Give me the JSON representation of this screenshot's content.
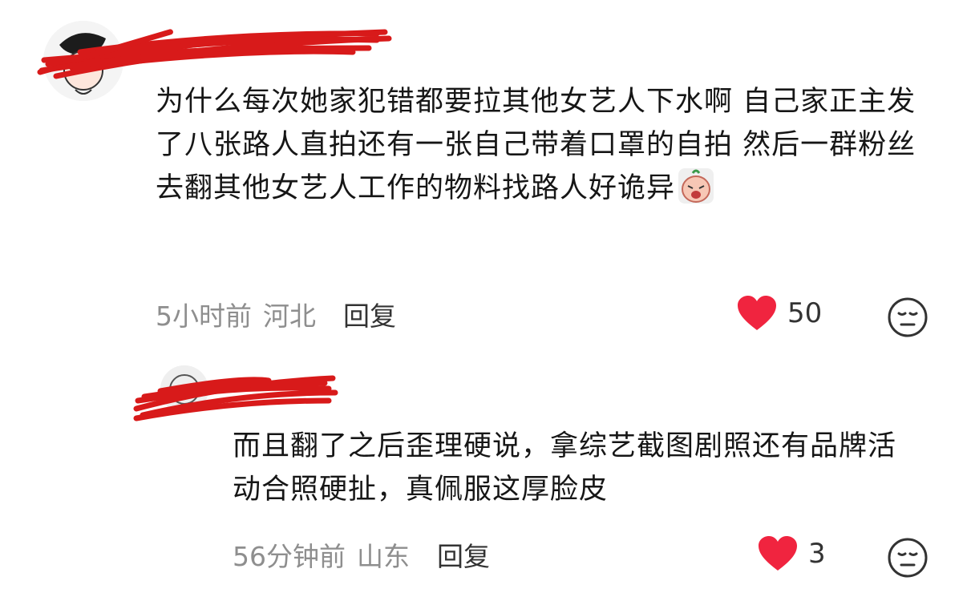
{
  "comments": [
    {
      "text": "为什么每次她家犯错都要拉其他女艺人下水啊 自己家正主发了八张路人直拍还有一张自己带着口罩的自拍 然后一群粉丝去翻其他女艺人工作的物料找路人好诡异",
      "time": "5小时前",
      "region": "河北",
      "reply_label": "回复",
      "likes": "50"
    },
    {
      "text": "而且翻了之后歪理硬说，拿综艺截图剧照还有品牌活动合照硬扯，真佩服这厚脸皮",
      "time": "56分钟前",
      "region": "山东",
      "reply_label": "回复",
      "likes": "3"
    }
  ],
  "icons": {
    "like": "heart-icon",
    "dislike": "neutral-face-icon",
    "inline_emoji": "crying-emoji"
  },
  "colors": {
    "heart": "#f0243f",
    "redaction": "#d81a1a",
    "meta_text": "#8e8e8e"
  }
}
